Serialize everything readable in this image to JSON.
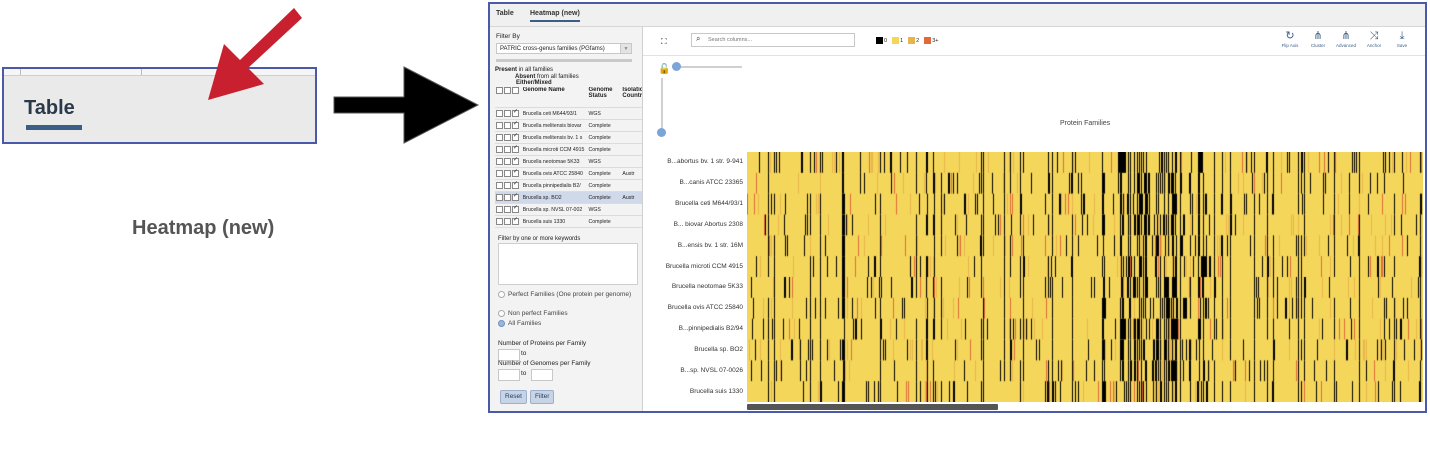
{
  "inset": {
    "tab_table": "Table",
    "tab_heatmap": "Heatmap (new)"
  },
  "app": {
    "tabs": [
      "Table",
      "Heatmap (new)"
    ],
    "filter": {
      "filter_by_label": "Filter By",
      "family_select": "PATRIC cross-genus families (PGfams)",
      "present_label": "Present",
      "present_text": "in all families",
      "absent_label": "Absent",
      "absent_text": "from all families",
      "either_label": "Either/Mixed",
      "columns": [
        "Genome Name",
        "Genome Status",
        "Isolation Country"
      ],
      "genomes": [
        {
          "name": "Brucella ceti M644/93/1",
          "status": "WGS",
          "country": ""
        },
        {
          "name": "Brucella melitensis biovar",
          "status": "Complete",
          "country": ""
        },
        {
          "name": "Brucella melitensis bv. 1 s",
          "status": "Complete",
          "country": ""
        },
        {
          "name": "Brucella microti CCM 4915",
          "status": "Complete",
          "country": ""
        },
        {
          "name": "Brucella neotomae 5K33",
          "status": "WGS",
          "country": ""
        },
        {
          "name": "Brucella ovis ATCC 25840",
          "status": "Complete",
          "country": "Austr"
        },
        {
          "name": "Brucella pinnipedialis B2/",
          "status": "Complete",
          "country": ""
        },
        {
          "name": "Brucella sp. BO2",
          "status": "Complete",
          "country": "Austr"
        },
        {
          "name": "Brucella sp. NVSL 07-002",
          "status": "WGS",
          "country": ""
        },
        {
          "name": "Brucella suis 1330",
          "status": "Complete",
          "country": ""
        }
      ],
      "keyword_label": "Filter by one or more keywords",
      "radio_perfect": "Perfect Families (One protein per genome)",
      "radio_nonperfect": "Non perfect Families",
      "radio_all": "All Families",
      "proteins_label": "Number of Proteins per Family",
      "genomes_label": "Number of Genomes per Family",
      "to": "to",
      "reset": "Reset",
      "filter": "Filter"
    },
    "heatmap": {
      "search_placeholder": "Search columns...",
      "legend": [
        {
          "label": "0",
          "color": "#000000"
        },
        {
          "label": "1",
          "color": "#f4d65a"
        },
        {
          "label": "2",
          "color": "#e8b54a"
        },
        {
          "label": "3+",
          "color": "#e06a3a"
        }
      ],
      "tools": [
        {
          "label": "Flip Axis",
          "icon": "flip-axis-icon"
        },
        {
          "label": "Cluster",
          "icon": "cluster-icon"
        },
        {
          "label": "Advanced",
          "icon": "advanced-cluster-icon"
        },
        {
          "label": "Anchor",
          "icon": "anchor-icon"
        },
        {
          "label": "Save",
          "icon": "download-icon"
        }
      ],
      "column_axis_title": "Protein Families",
      "rows": [
        "B...abortus bv. 1 str. 9-941",
        "B...canis ATCC 23365",
        "Brucella ceti M644/93/1",
        "B... biovar Abortus 2308",
        "B...ensis bv. 1 str. 16M",
        "Brucella microti CCM 4915",
        "Brucella neotomae 5K33",
        "Brucella ovis ATCC 25840",
        "B...pinnipedialis B2/94",
        "Brucella sp. BO2",
        "B...sp. NVSL 07-0026",
        "Brucella suis 1330"
      ]
    }
  }
}
